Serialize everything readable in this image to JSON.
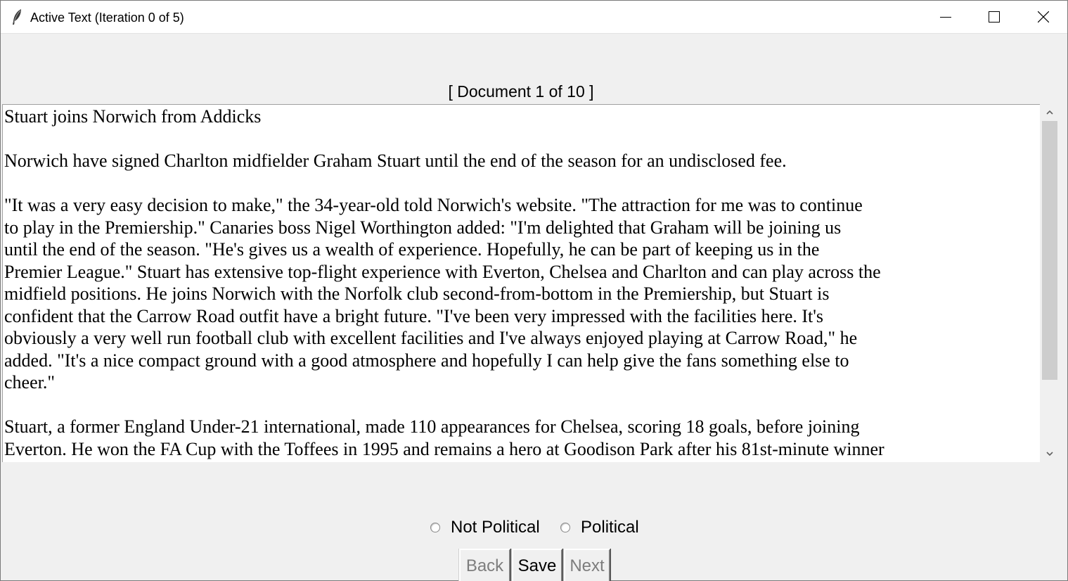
{
  "window": {
    "title": "Active Text (Iteration 0 of 5)",
    "icon": "feather-icon",
    "controls": [
      "minimize-icon",
      "maximize-icon",
      "close-icon"
    ]
  },
  "document": {
    "label": "[ Document 1 of 10 ]",
    "text": "Stuart joins Norwich from Addicks\n\nNorwich have signed Charlton midfielder Graham Stuart until the end of the season for an undisclosed fee.\n\n\"It was a very easy decision to make,\" the 34-year-old told Norwich's website. \"The attraction for me was to continue\nto play in the Premiership.\" Canaries boss Nigel Worthington added: \"I'm delighted that Graham will be joining us\nuntil the end of the season. \"He's gives us a wealth of experience. Hopefully, he can be part of keeping us in the\nPremier League.\" Stuart has extensive top-flight experience with Everton, Chelsea and Charlton and can play across the\nmidfield positions. He joins Norwich with the Norfolk club second-from-bottom in the Premiership, but Stuart is\nconfident that the Carrow Road outfit have a bright future. \"I've been very impressed with the facilities here. It's\nobviously a very well run football club with excellent facilities and I've always enjoyed playing at Carrow Road,\" he\nadded. \"It's a nice compact ground with a good atmosphere and hopefully I can help give the fans something else to\ncheer.\"\n\nStuart, a former England Under-21 international, made 110 appearances for Chelsea, scoring 18 goals, before joining\nEverton. He won the FA Cup with the Toffees in 1995 and remains a hero at Goodison Park after his 81st-minute winner"
  },
  "labels": {
    "not_political": "Not Political",
    "political": "Political"
  },
  "selected_label": null,
  "buttons": {
    "back": "Back",
    "save": "Save",
    "next": "Next"
  },
  "colors": {
    "window_bg": "#f0f0f0",
    "text_bg": "#ffffff",
    "disabled_text": "#7d7d7d",
    "scroll_thumb": "#cdcdcd"
  }
}
